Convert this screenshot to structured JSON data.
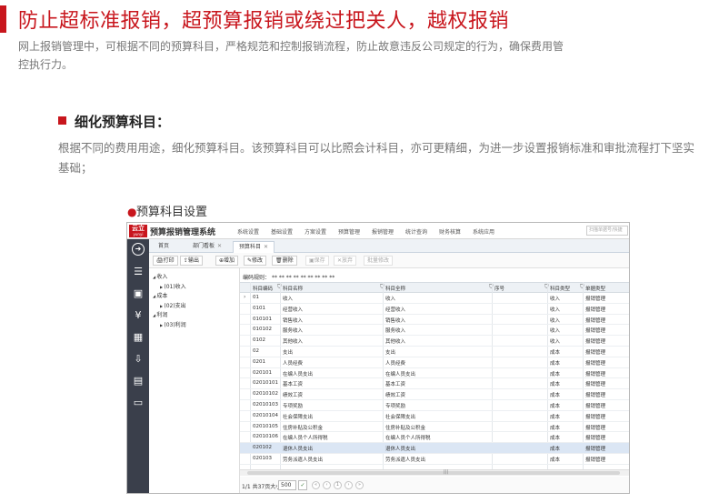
{
  "headline": "防止超标准报销，超预算报销或绕过把关人，越权报销",
  "intro": "网上报销管理中，可根据不同的预算科目，严格规范和控制报销流程，防止故意违反公司规定的行为，确保费用管控执行力。",
  "section": {
    "title": "细化预算科目：",
    "desc": "根据不同的费用用途，细化预算科目。该预算科目可以比照会计科目，亦可更精细，为进一步设置报销标准和审批流程打下坚实基础；"
  },
  "caption": "预算科目设置",
  "colors": {
    "accent": "#c8161d",
    "sidebar": "#3a3f4b",
    "selected_row": "#dbe6f4"
  },
  "app": {
    "logo_main": "云立",
    "logo_sub": "yunyi",
    "title": "预算报销管理系统",
    "menu": [
      "系统设置",
      "基础设置",
      "方案设置",
      "预算管理",
      "报销管理",
      "统计查询",
      "财务核算",
      "系统应用"
    ],
    "search_placeholder": "扫描单据号/快捷",
    "sidebar_icons": [
      "arrow-right-circle-icon",
      "list-icon",
      "wallet-icon",
      "money-icon",
      "calendar-icon",
      "download-icon",
      "document-icon",
      "card-icon"
    ],
    "tabs": [
      {
        "label": "首页"
      },
      {
        "label": "部门看板",
        "close": "✕"
      },
      {
        "label": "预算科目",
        "close": "✕",
        "active": true
      }
    ],
    "toolbar": {
      "print": "打印",
      "export": "输出",
      "add": "增加",
      "edit": "修改",
      "delete": "删除",
      "save": "保存",
      "cancel": "放弃",
      "batch_edit": "批量修改"
    },
    "tree": [
      {
        "label": "收入",
        "level": 0,
        "expanded": true
      },
      {
        "label": "(01)收入",
        "level": 1,
        "expanded": false
      },
      {
        "label": "成本",
        "level": 0,
        "expanded": true
      },
      {
        "label": "(02)支出",
        "level": 1,
        "expanded": false
      },
      {
        "label": "利润",
        "level": 0,
        "expanded": true
      },
      {
        "label": "(03)利润",
        "level": 1,
        "expanded": false
      }
    ],
    "rule_label": "编码规则：",
    "rule_value": "** ** ** ** ** ** ** ** **",
    "columns": [
      "科目编码",
      "科目名称",
      "科目全称",
      "序号",
      "科目类型",
      "单据类型"
    ],
    "rows": [
      [
        "01",
        "收入",
        "收入",
        "",
        "收入",
        "报销管理"
      ],
      [
        "0101",
        "经营收入",
        "经营收入",
        "",
        "收入",
        "报销管理"
      ],
      [
        "010101",
        "销售收入",
        "销售收入",
        "",
        "收入",
        "报销管理"
      ],
      [
        "010102",
        "服务收入",
        "服务收入",
        "",
        "收入",
        "报销管理"
      ],
      [
        "0102",
        "其他收入",
        "其他收入",
        "",
        "收入",
        "报销管理"
      ],
      [
        "02",
        "支出",
        "支出",
        "",
        "成本",
        "报销管理"
      ],
      [
        "0201",
        "人员经费",
        "人员经费",
        "",
        "成本",
        "报销管理"
      ],
      [
        "020101",
        "在编人员支出",
        "在编人员支出",
        "",
        "成本",
        "报销管理"
      ],
      [
        "02010101",
        "基本工资",
        "基本工资",
        "",
        "成本",
        "报销管理"
      ],
      [
        "02010102",
        "绩效工资",
        "绩效工资",
        "",
        "成本",
        "报销管理"
      ],
      [
        "02010103",
        "专项奖励",
        "专项奖励",
        "",
        "成本",
        "报销管理"
      ],
      [
        "02010104",
        "社会保障支出",
        "社会保障支出",
        "",
        "成本",
        "报销管理"
      ],
      [
        "02010105",
        "住房补贴及公积金",
        "住房补贴及公积金",
        "",
        "成本",
        "报销管理"
      ],
      [
        "02010106",
        "在编人员个人所得税",
        "在编人员个人所得税",
        "",
        "成本",
        "报销管理"
      ],
      [
        "020102",
        "退休人员支出",
        "退休人员支出",
        "",
        "成本",
        "报销管理"
      ],
      [
        "020103",
        "劳务派遣人员支出",
        "劳务派遣人员支出",
        "",
        "成本",
        "报销管理"
      ]
    ],
    "selected_row": 14,
    "pager": {
      "info": "1/1 共37页大小",
      "size": "500",
      "ok": "✓"
    }
  }
}
